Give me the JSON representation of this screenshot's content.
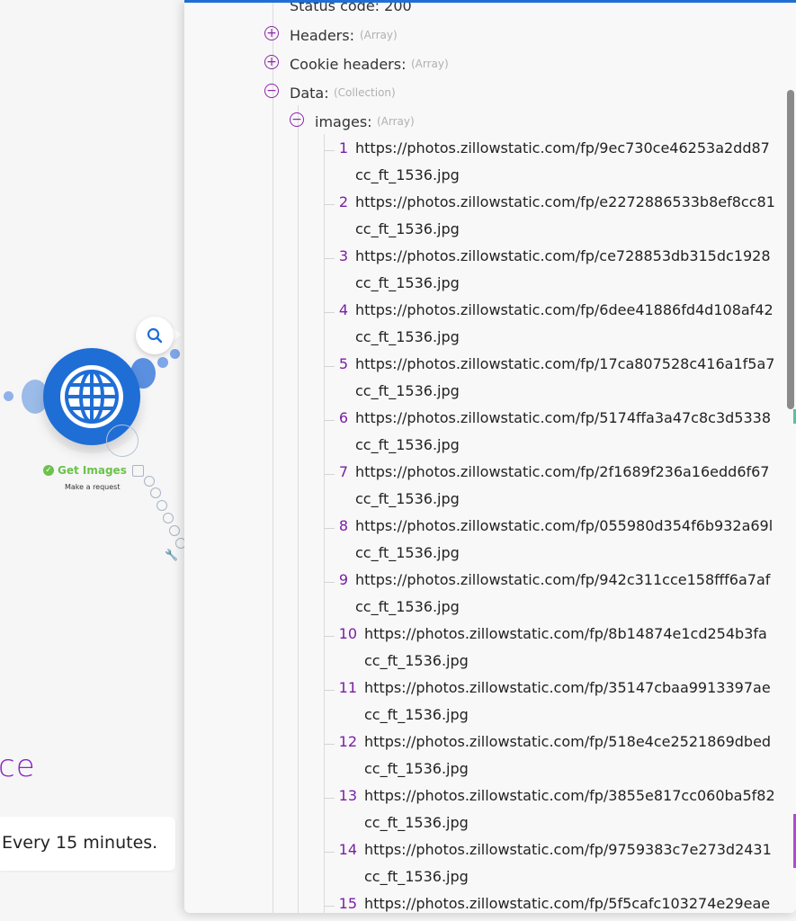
{
  "canvas": {
    "module": {
      "name": "Get Images",
      "subtitle": "Make a request",
      "icon": "globe-icon",
      "color": "#1f6ed6"
    },
    "scenario_title_fragment": "ce",
    "schedule_text": "Every 15 minutes."
  },
  "output": {
    "status_line": "Status code: 200",
    "headers": {
      "label": "Headers:",
      "type": "(Array)"
    },
    "cookie_headers": {
      "label": "Cookie headers:",
      "type": "(Array)"
    },
    "data": {
      "label": "Data:",
      "type": "(Collection)"
    },
    "images": {
      "label": "images:",
      "type": "(Array)",
      "items": [
        {
          "index": "1",
          "url": "https://photos.zillowstatic.com/fp/9ec730ce46253a2dd87",
          "suffix": "cc_ft_1536.jpg"
        },
        {
          "index": "2",
          "url": "https://photos.zillowstatic.com/fp/e2272886533b8ef8cc81",
          "suffix": "cc_ft_1536.jpg"
        },
        {
          "index": "3",
          "url": "https://photos.zillowstatic.com/fp/ce728853db315dc1928",
          "suffix": "cc_ft_1536.jpg"
        },
        {
          "index": "4",
          "url": "https://photos.zillowstatic.com/fp/6dee41886fd4d108af42",
          "suffix": "cc_ft_1536.jpg"
        },
        {
          "index": "5",
          "url": "https://photos.zillowstatic.com/fp/17ca807528c416a1f5a7",
          "suffix": "cc_ft_1536.jpg"
        },
        {
          "index": "6",
          "url": "https://photos.zillowstatic.com/fp/5174ffa3a47c8c3d5338",
          "suffix": "cc_ft_1536.jpg"
        },
        {
          "index": "7",
          "url": "https://photos.zillowstatic.com/fp/2f1689f236a16edd6f67",
          "suffix": "cc_ft_1536.jpg"
        },
        {
          "index": "8",
          "url": "https://photos.zillowstatic.com/fp/055980d354f6b932a69l",
          "suffix": "cc_ft_1536.jpg"
        },
        {
          "index": "9",
          "url": "https://photos.zillowstatic.com/fp/942c311cce158fff6a7af",
          "suffix": "cc_ft_1536.jpg"
        },
        {
          "index": "10",
          "url": "https://photos.zillowstatic.com/fp/8b14874e1cd254b3fa",
          "suffix": "cc_ft_1536.jpg"
        },
        {
          "index": "11",
          "url": "https://photos.zillowstatic.com/fp/35147cbaa9913397ae",
          "suffix": "cc_ft_1536.jpg"
        },
        {
          "index": "12",
          "url": "https://photos.zillowstatic.com/fp/518e4ce2521869dbed",
          "suffix": "cc_ft_1536.jpg"
        },
        {
          "index": "13",
          "url": "https://photos.zillowstatic.com/fp/3855e817cc060ba5f82",
          "suffix": "cc_ft_1536.jpg"
        },
        {
          "index": "14",
          "url": "https://photos.zillowstatic.com/fp/9759383c7e273d2431",
          "suffix": "cc_ft_1536.jpg"
        },
        {
          "index": "15",
          "url": "https://photos.zillowstatic.com/fp/5f5cafc103274e29eae",
          "suffix": ""
        }
      ]
    }
  },
  "colors": {
    "accent": "#1f6ed6",
    "toggle": "#8e24aa",
    "success": "#6cc24a"
  }
}
